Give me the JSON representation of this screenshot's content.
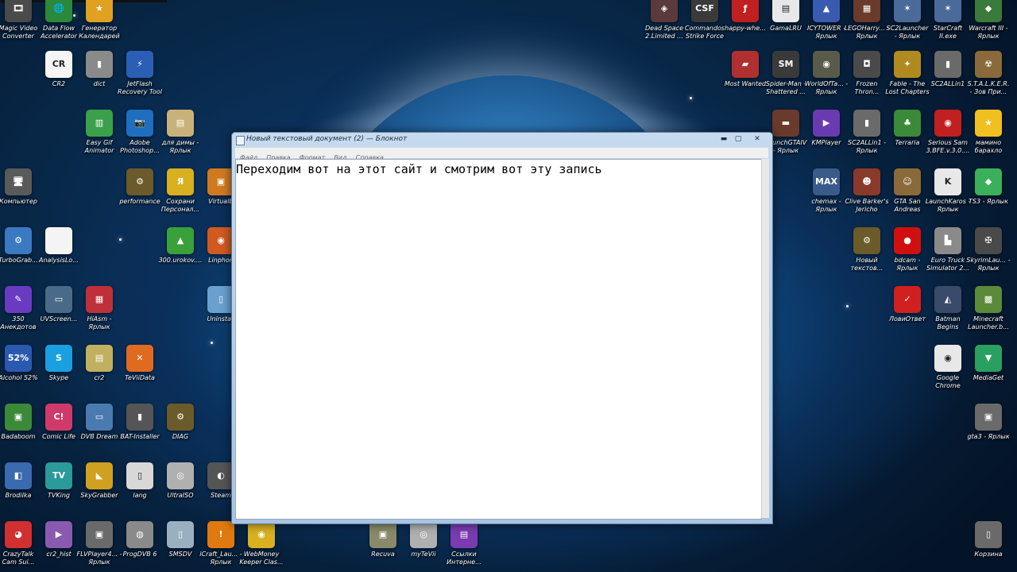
{
  "window": {
    "title": "Новый текстовый документ (2) — Блокнот",
    "minimize": "▬",
    "maximize": "▢",
    "close": "✕",
    "menu": [
      "Файл",
      "Правка",
      "Формат",
      "Вид",
      "Справка"
    ],
    "content": "Переходим вот на этот сайт и смотрим вот эту запись"
  },
  "icons": [
    {
      "label": "Magic Video Converter",
      "glyph": "🎞",
      "color": "#4a4a4a",
      "icon": "film-reel-icon"
    },
    {
      "label": "Data Flow Accelerator",
      "glyph": "🌐",
      "color": "#2a8a3a",
      "icon": "globe-icon"
    },
    {
      "label": "Генератор Календарей",
      "glyph": "★",
      "color": "#e0a020",
      "icon": "sun-icon"
    },
    {
      "label": "CR2",
      "glyph": "CR",
      "color": "#f5f5f5",
      "icon": "cr2-icon"
    },
    {
      "label": "dict",
      "glyph": "▮",
      "color": "#8a8a8a",
      "icon": "book-icon"
    },
    {
      "label": "JetFlash Recovery Tool",
      "glyph": "⚡",
      "color": "#2b5fb5",
      "icon": "jetflash-icon"
    },
    {
      "label": "Easy Gif Animator",
      "glyph": "▥",
      "color": "#3aa04a",
      "icon": "gif-icon"
    },
    {
      "label": "Adobe Photoshop...",
      "glyph": "📷",
      "color": "#1e6fc0",
      "icon": "camera-icon"
    },
    {
      "label": "для димы - Ярлык",
      "glyph": "▤",
      "color": "#c9b27a",
      "icon": "archive-icon"
    },
    {
      "label": "Компьютер",
      "glyph": "🖥",
      "color": "#5a5a5a",
      "icon": "computer-icon"
    },
    {
      "label": "performance",
      "glyph": "⚙",
      "color": "#6b5a2a",
      "icon": "gear-folder-icon"
    },
    {
      "label": "Сохрани Персонал...",
      "glyph": "Я",
      "color": "#d8b020",
      "icon": "yandex-icon"
    },
    {
      "label": "VirtualB",
      "glyph": "▣",
      "color": "#d07a20",
      "icon": "virtualbox-icon"
    },
    {
      "label": "TurboGrab...",
      "glyph": "⚙",
      "color": "#3a7ac0",
      "icon": "gear-icon"
    },
    {
      "label": "AnalysisLo...",
      "glyph": "",
      "color": "#f4f4f4",
      "icon": "blank-document-icon"
    },
    {
      "label": "300.urokov....",
      "glyph": "▲",
      "color": "#3aa03a",
      "icon": "house-icon"
    },
    {
      "label": "Linphon",
      "glyph": "◉",
      "color": "#d05a20",
      "icon": "linphone-icon"
    },
    {
      "label": "350 Анекдотов",
      "glyph": "✎",
      "color": "#6a3ac0",
      "icon": "pen-icon"
    },
    {
      "label": "UVScreen...",
      "glyph": "▭",
      "color": "#4a6a8a",
      "icon": "screen-camera-icon"
    },
    {
      "label": "HiAsm - Ярлык",
      "glyph": "▦",
      "color": "#c0303a",
      "icon": "hiasm-icon"
    },
    {
      "label": "Uninstall",
      "glyph": "▯",
      "color": "#6aa0d0",
      "icon": "trash-bin-icon"
    },
    {
      "label": "Alcohol 52%",
      "glyph": "52%",
      "color": "#2a5ab0",
      "icon": "alcohol-icon"
    },
    {
      "label": "Skype",
      "glyph": "S",
      "color": "#1aa0e0",
      "icon": "skype-icon"
    },
    {
      "label": "cr2",
      "glyph": "▤",
      "color": "#c0b060",
      "icon": "zip-icon"
    },
    {
      "label": "TeViiData",
      "glyph": "✕",
      "color": "#e06a20",
      "icon": "teviidata-icon"
    },
    {
      "label": "Badaboom",
      "glyph": "▣",
      "color": "#3a8a3a",
      "icon": "badaboom-icon"
    },
    {
      "label": "Comic Life",
      "glyph": "C!",
      "color": "#d03a6a",
      "icon": "comic-icon"
    },
    {
      "label": "DVB Dream",
      "glyph": "▭",
      "color": "#4a7ab0",
      "icon": "dvb-icon"
    },
    {
      "label": "BAT-Installer",
      "glyph": "▮",
      "color": "#555555",
      "icon": "bat-icon"
    },
    {
      "label": "DIAG",
      "glyph": "⚙",
      "color": "#6b5a2a",
      "icon": "diag-icon"
    },
    {
      "label": "Brodilka",
      "glyph": "◧",
      "color": "#3a6ab0",
      "icon": "brodilka-icon"
    },
    {
      "label": "TVKing",
      "glyph": "TV",
      "color": "#2a9a9a",
      "icon": "tv-icon"
    },
    {
      "label": "SkyGrabber",
      "glyph": "◣",
      "color": "#d0a020",
      "icon": "skygrabber-icon"
    },
    {
      "label": "lang",
      "glyph": "▯",
      "color": "#d8d8d8",
      "icon": "lang-icon"
    },
    {
      "label": "UltraISO",
      "glyph": "◎",
      "color": "#b0b0b0",
      "icon": "disc-icon"
    },
    {
      "label": "Steam",
      "glyph": "◐",
      "color": "#555555",
      "icon": "steam-icon"
    },
    {
      "label": "CrazyTalk Cam Sui...",
      "glyph": "◕",
      "color": "#d03030",
      "icon": "crazytalk-icon"
    },
    {
      "label": "cr2_hist",
      "glyph": "▶",
      "color": "#8a5ab0",
      "icon": "video-file-icon"
    },
    {
      "label": "FLVPlayer4... - Ярлык",
      "glyph": "▣",
      "color": "#6a6a6a",
      "icon": "film-icon"
    },
    {
      "label": "ProgDVB 6",
      "glyph": "◍",
      "color": "#8a8a8a",
      "icon": "satellite-icon"
    },
    {
      "label": "SMSDV",
      "glyph": "▯",
      "color": "#9ab0c0",
      "icon": "phone-icon"
    },
    {
      "label": "iCraft_Lau... - Ярлык",
      "glyph": "!",
      "color": "#e07a10",
      "icon": "warning-icon"
    },
    {
      "label": "WebMoney Keeper Clas...",
      "glyph": "◉",
      "color": "#d8b020",
      "icon": "webmoney-icon"
    },
    {
      "label": "Recuva",
      "glyph": "▣",
      "color": "#8a8a6a",
      "icon": "recuva-icon"
    },
    {
      "label": "myTeVii",
      "glyph": "◎",
      "color": "#b0b0b0",
      "icon": "tevii-disc-icon"
    },
    {
      "label": "Ссылки Интерне...",
      "glyph": "▤",
      "color": "#7a3ab0",
      "icon": "books-icon"
    },
    {
      "label": "Dead Space 2.Limited ...",
      "glyph": "◈",
      "color": "#5a3a3a",
      "icon": "deadspace-icon"
    },
    {
      "label": "Commandos Strike Force",
      "glyph": "CSF",
      "color": "#3a3a3a",
      "icon": "commandos-icon"
    },
    {
      "label": "happy-whe...",
      "glyph": "ƒ",
      "color": "#c02020",
      "icon": "flash-icon"
    },
    {
      "label": "GamaLRU",
      "glyph": "▤",
      "color": "#e8e8e8",
      "icon": "text-file-icon"
    },
    {
      "label": "ICYTOWER - Ярлык",
      "glyph": "▲",
      "color": "#3a5ab0",
      "icon": "icytower-icon"
    },
    {
      "label": "LEGOHarry... - Ярлык",
      "glyph": "▦",
      "color": "#6a3a2a",
      "icon": "lego-icon"
    },
    {
      "label": "SC2Launcher - Ярлык",
      "glyph": "✶",
      "color": "#4a6a9a",
      "icon": "sc2-icon"
    },
    {
      "label": "StarCraft II.exe",
      "glyph": "✶",
      "color": "#4a6a9a",
      "icon": "starcraft-icon"
    },
    {
      "label": "Warcraft III - Ярлык",
      "glyph": "◆",
      "color": "#3a7a3a",
      "icon": "warcraft-icon"
    },
    {
      "label": "Most Wanted",
      "glyph": "▰",
      "color": "#b03030",
      "icon": "nfs-icon"
    },
    {
      "label": "Spider-Man - Shattered ...",
      "glyph": "SM",
      "color": "#3a3a3a",
      "icon": "spiderman-icon"
    },
    {
      "label": "WorldOfTa... - Ярлык",
      "glyph": "◉",
      "color": "#5a5a4a",
      "icon": "wot-icon"
    },
    {
      "label": "Frozen Thron...",
      "glyph": "◘",
      "color": "#4a4a4a",
      "icon": "frozen-throne-icon"
    },
    {
      "label": "Fable - The Lost Chapters",
      "glyph": "✦",
      "color": "#b08a20",
      "icon": "fable-icon"
    },
    {
      "label": "SC2ALLin1",
      "glyph": "▮",
      "color": "#6a6a6a",
      "icon": "chip-icon"
    },
    {
      "label": "S.T.A.L.K.E.R. - Зов При...",
      "glyph": "☢",
      "color": "#8a6a3a",
      "icon": "stalker-icon"
    },
    {
      "label": "LaunchGTAIV - Ярлык",
      "glyph": "▬",
      "color": "#6a3a2a",
      "icon": "gtaiv-icon"
    },
    {
      "label": "KMPlayer",
      "glyph": "▶",
      "color": "#6a3ab0",
      "icon": "kmplayer-icon"
    },
    {
      "label": "SC2ALLin1 - Ярлык",
      "glyph": "▮",
      "color": "#6a6a6a",
      "icon": "chip-shortcut-icon"
    },
    {
      "label": "Terraria",
      "glyph": "♣",
      "color": "#3a8a3a",
      "icon": "terraria-icon"
    },
    {
      "label": "Serious Sam 3.BFE.v.3.0....",
      "glyph": "◉",
      "color": "#c02020",
      "icon": "serious-sam-icon"
    },
    {
      "label": "мамино барахло",
      "glyph": "★",
      "color": "#f0c020",
      "icon": "star-icon"
    },
    {
      "label": "chemax - Ярлык",
      "glyph": "MAX",
      "color": "#3a5a8a",
      "icon": "chemax-icon"
    },
    {
      "label": "Clive Barker's Jericho",
      "glyph": "☻",
      "color": "#8a3a2a",
      "icon": "jericho-icon"
    },
    {
      "label": "GTA San Andreas",
      "glyph": "☺",
      "color": "#8a6a3a",
      "icon": "gta-sa-icon"
    },
    {
      "label": "LaunchKaros - Ярлык",
      "glyph": "K",
      "color": "#e8e8e8",
      "icon": "karos-icon"
    },
    {
      "label": "TS3 - Ярлык",
      "glyph": "◆",
      "color": "#3ab05a",
      "icon": "sims3-icon"
    },
    {
      "label": "Новый текстов...",
      "glyph": "⚙",
      "color": "#6b5a2a",
      "icon": "text-folder-icon"
    },
    {
      "label": "bdcam - Ярлык",
      "glyph": "●",
      "color": "#d01010",
      "icon": "record-icon"
    },
    {
      "label": "Euro Truck Simulator 2...",
      "glyph": "▙",
      "color": "#8a8a8a",
      "icon": "truck-icon"
    },
    {
      "label": "SkyrimLau... - Ярлык",
      "glyph": "✠",
      "color": "#4a4a4a",
      "icon": "skyrim-icon"
    },
    {
      "label": "ЛовиОтвет",
      "glyph": "✓",
      "color": "#d02020",
      "icon": "loviotvet-icon"
    },
    {
      "label": "Batman Begins",
      "glyph": "◭",
      "color": "#3a4a6a",
      "icon": "batman-icon"
    },
    {
      "label": "Minecraft Launcher.b...",
      "glyph": "▩",
      "color": "#5a8a3a",
      "icon": "minecraft-icon"
    },
    {
      "label": "Google Chrome",
      "glyph": "◉",
      "color": "#e8e8e8",
      "icon": "chrome-icon"
    },
    {
      "label": "MediaGet",
      "glyph": "▼",
      "color": "#2aa060",
      "icon": "mediaget-icon"
    },
    {
      "label": "gta3 - Ярлык",
      "glyph": "▣",
      "color": "#6a6a6a",
      "icon": "gta3-icon"
    },
    {
      "label": "Корзина",
      "glyph": "▯",
      "color": "#6a6a6a",
      "icon": "recycle-bin-icon"
    }
  ]
}
